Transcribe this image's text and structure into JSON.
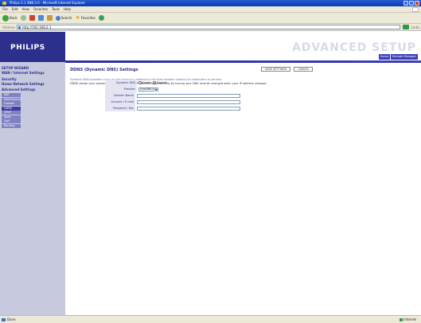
{
  "browser": {
    "title": "Philips 2.1 SNB 2.0 - Microsoft Internet Explorer",
    "menu": [
      "File",
      "Edit",
      "View",
      "Favorites",
      "Tools",
      "Help"
    ],
    "toolbar": {
      "back": "Back",
      "search": "Search",
      "favorites": "Favorites"
    },
    "address_label": "Address",
    "address_value": "http://192.168.2.1",
    "go": "Go",
    "links": "Links"
  },
  "header": {
    "logo": "PHILIPS",
    "tagline": "ADVANCED SETUP",
    "buttons": [
      "Home",
      "Remote Manager"
    ]
  },
  "sidebar": {
    "main_items": [
      "SETUP WIZARD",
      "WAN / Internet Settings",
      "Security",
      "Home Network Settings",
      "Advanced Settings"
    ],
    "sub_items": [
      "NAT",
      "Maintenance",
      "Firewall",
      "DDNS",
      "UPnP",
      "Tools",
      "QoS",
      "Routing"
    ],
    "active_sub": "DDNS"
  },
  "main": {
    "title": "DDNS (Dynamic DNS) Settings",
    "desc_line1": "Dynamic DNS provides users on the Internet a method to link their domain name(s) to computers or servers.",
    "desc_line2": "DDNS allows your domain name to follow your IP address automatically by having your DNS records changed when your IP address changes.",
    "save_button": "SAVE SETTINGS",
    "cancel_button": "CANCEL",
    "form": {
      "dynamic_dns_label": "Dynamic DNS",
      "enable_label": "Enable",
      "disable_label": "Disable",
      "provider_label": "Provider",
      "provider_value": "DynDNS.org",
      "domain_label": "Domain Name",
      "account_label": "Account / E-mail",
      "password_label": "Password / Key"
    }
  },
  "statusbar": {
    "left": "Done",
    "right": "Internet"
  }
}
